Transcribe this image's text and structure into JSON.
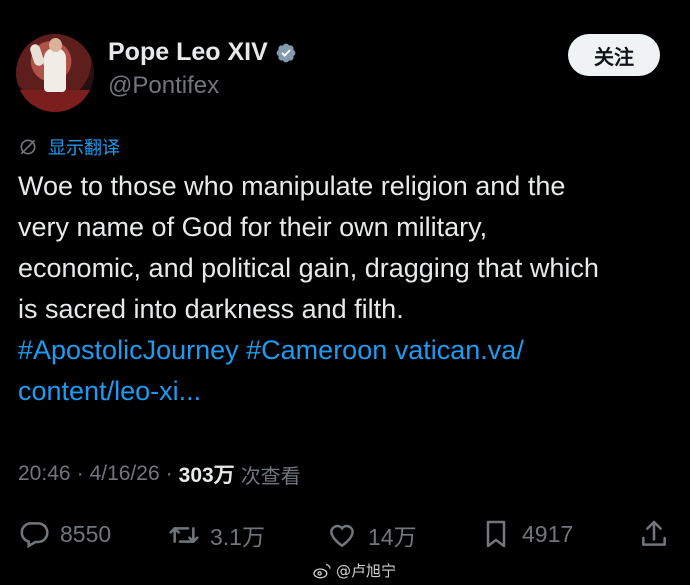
{
  "user": {
    "display_name": "Pope Leo XIV",
    "handle": "@Pontifex",
    "verified": true,
    "follow_label": "关注"
  },
  "translate": {
    "icon": "translate-icon",
    "label": "显示翻译"
  },
  "tweet": {
    "line1": "Woe to those who manipulate religion and the",
    "line2": "very name of God for their own military,",
    "line3": "economic, and political gain, dragging that which",
    "line4": "is sacred into darkness and filth.",
    "hashtag1": "#ApostolicJourney",
    "hashtag2": "#Cameroon",
    "link_part1": "vatican.va/",
    "link_part2": "content/leo-xi..."
  },
  "meta": {
    "time": "20:46",
    "separator1": "·",
    "date": "4/16/26",
    "separator2": "·",
    "views": "303万",
    "views_label": "次查看"
  },
  "actions": {
    "reply_count": "8550",
    "repost_count": "3.1万",
    "like_count": "14万",
    "bookmark_count": "4917"
  },
  "watermark": {
    "text": "@卢旭宁"
  },
  "colors": {
    "background": "#000000",
    "text": "#e7e9ea",
    "secondary": "#71767b",
    "link": "#1d9bf0",
    "verified": "#829aab"
  }
}
